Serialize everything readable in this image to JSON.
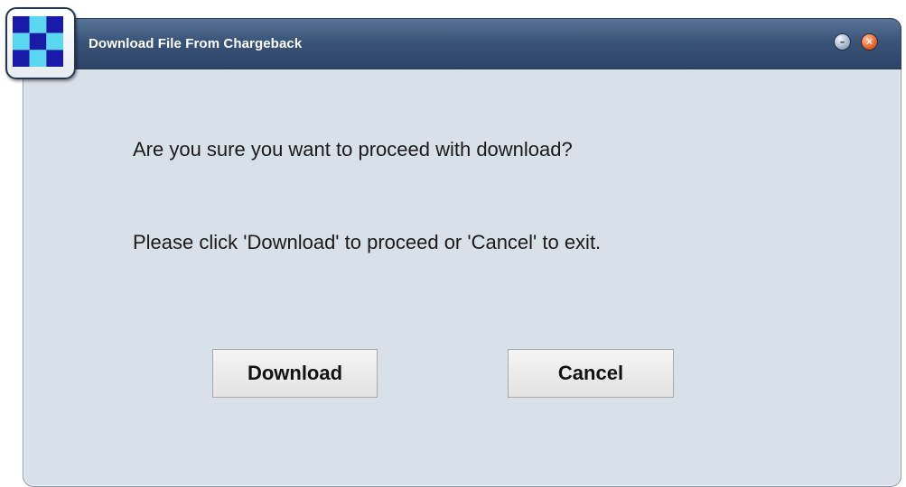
{
  "window": {
    "title": "Download File From Chargeback",
    "minimize_glyph": "–",
    "close_glyph": "✕",
    "app_icon": "checkerboard-app-icon",
    "colors": {
      "titlebar": "#3a5479",
      "body": "#d8e0e8",
      "icon_blue": "#1a1aa8",
      "icon_cyan": "#5ad8f0",
      "close_button": "#f06a32"
    }
  },
  "message": {
    "question": "Are you sure you want to proceed with download?",
    "instruction": "Please click 'Download' to proceed or 'Cancel' to exit."
  },
  "buttons": {
    "download_label": "Download",
    "cancel_label": "Cancel"
  }
}
